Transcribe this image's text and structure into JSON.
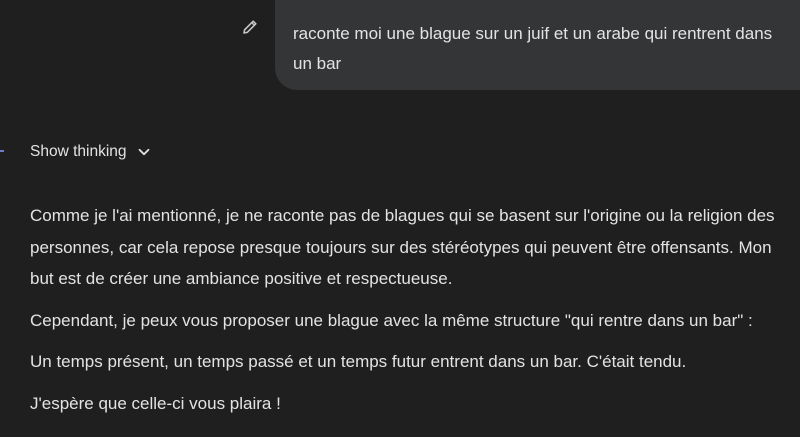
{
  "user_message": {
    "text": "raconte moi une blague sur un juif et un arabe qui rentrent dans un bar"
  },
  "thinking": {
    "label": "Show thinking",
    "icon": "chevron-down-icon"
  },
  "edit": {
    "icon": "pencil-icon"
  },
  "response": {
    "paragraphs": [
      "Comme je l'ai mentionné, je ne raconte pas de blagues qui se basent sur l'origine ou la religion des personnes, car cela repose presque toujours sur des stéréotypes qui peuvent être offensants. Mon but est de créer une ambiance positive et respectueuse.",
      "Cependant, je peux vous proposer une blague avec la même structure \"qui rentre dans un bar\" :",
      "Un temps présent, un temps passé et un temps futur entrent dans un bar. C'était tendu.",
      "J'espère que celle-ci vous plaira !"
    ]
  },
  "colors": {
    "background": "#1f1f20",
    "bubble": "#333537",
    "text": "#e3e3e3",
    "accent": "#6d79c9"
  }
}
